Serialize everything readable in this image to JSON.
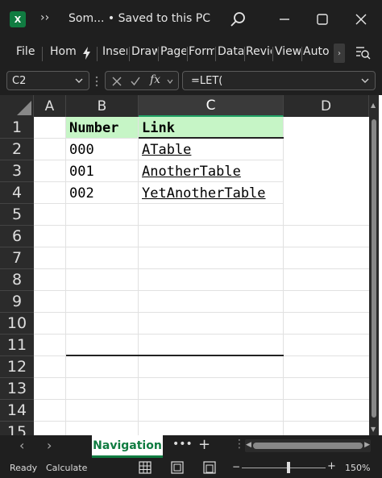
{
  "window": {
    "app_logo": "X",
    "more_glyph": "››",
    "title": "Som...  •  Saved to this PC",
    "search_icon": "search-icon",
    "min_icon": "minimize-icon",
    "max_icon": "maximize-icon",
    "close_icon": "close-icon"
  },
  "ribbon": {
    "tabs": [
      "File",
      "Hom",
      "",
      "Inser",
      "Draw",
      "Page",
      "Form",
      "Data",
      "Revie",
      "View",
      "Auto"
    ],
    "scroll_glyph": "›"
  },
  "formula_bar": {
    "name_box": "C2",
    "fx_label": "fx",
    "formula": "=LET("
  },
  "sheet": {
    "columns": [
      "A",
      "B",
      "C",
      "D"
    ],
    "rows": [
      "1",
      "2",
      "3",
      "4",
      "5",
      "6",
      "7",
      "8",
      "9",
      "10",
      "11",
      "12",
      "13",
      "14",
      "15"
    ],
    "cells": {
      "B1": "Number",
      "C1": "Link",
      "B2": "000",
      "C2": "ATable",
      "B3": "001",
      "C3": "AnotherTable",
      "B4": "002",
      "C4": "YetAnotherTable"
    },
    "header_fill_color": "#c6f5c6"
  },
  "sheet_tabs": {
    "prev_glyph": "‹",
    "next_glyph": "›",
    "active": "Navigation",
    "more_glyph": "•••",
    "add_glyph": "+",
    "sep_glyph": "⋮"
  },
  "status": {
    "ready": "Ready",
    "calculate": "Calculate",
    "zoom_minus": "−",
    "zoom_plus": "+",
    "zoom": "150%"
  },
  "colors": {
    "accent": "#107c41"
  }
}
